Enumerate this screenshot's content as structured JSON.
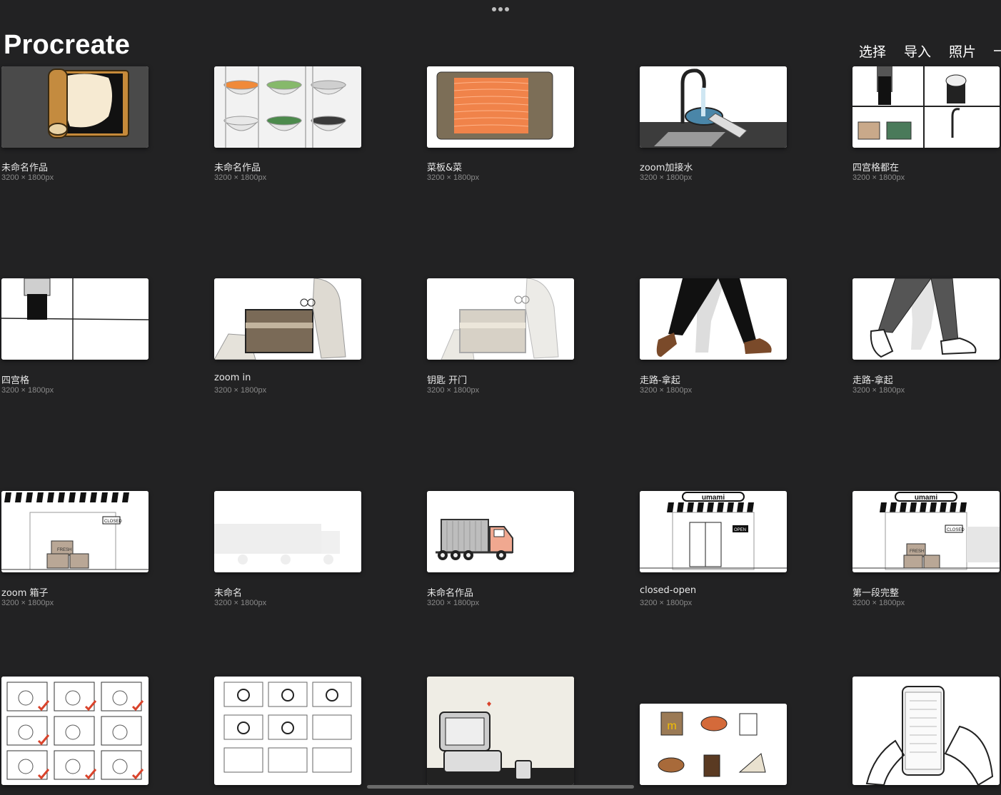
{
  "app": {
    "title": "Procreate"
  },
  "toolbar": {
    "select": "选择",
    "import": "导入",
    "photos": "照片"
  },
  "artworks": [
    {
      "title": "未命名作品",
      "size": "3200 × 1800px",
      "art": "rolling-pin"
    },
    {
      "title": "未命名作品",
      "size": "3200 × 1800px",
      "art": "bowls"
    },
    {
      "title": "菜板&菜",
      "size": "3200 × 1800px",
      "art": "salmon-board"
    },
    {
      "title": "zoom加接水",
      "size": "3200 × 1800px",
      "art": "faucet-bowl"
    },
    {
      "title": "四宫格都在",
      "size": "3200 × 1800px",
      "art": "four-grid-full"
    },
    {
      "title": "四宫格",
      "size": "3200 × 1800px",
      "art": "four-grid"
    },
    {
      "title": "zoom in",
      "size": "3200 × 1800px",
      "art": "key-box"
    },
    {
      "title": "钥匙 开门",
      "size": "3200 × 1800px",
      "art": "key-box-light"
    },
    {
      "title": "走路-拿起",
      "size": "3200 × 1800px",
      "art": "walking-legs"
    },
    {
      "title": "走路-拿起",
      "size": "3200 × 1800px",
      "art": "walking-legs-gray"
    },
    {
      "title": "zoom 箱子",
      "size": "3200 × 1800px",
      "art": "shop-boxes"
    },
    {
      "title": "未命名",
      "size": "3200 × 1800px",
      "art": "faded-truck"
    },
    {
      "title": "未命名作品",
      "size": "3200 × 1800px",
      "art": "truck"
    },
    {
      "title": "closed-open",
      "size": "3200 × 1800px",
      "art": "umami-shop"
    },
    {
      "title": "第一段完整",
      "size": "3200 × 1800px",
      "art": "umami-shop-boxes"
    },
    {
      "title": "",
      "size": "",
      "art": "storyboard-checks"
    },
    {
      "title": "",
      "size": "",
      "art": "storyboard-sketch"
    },
    {
      "title": "",
      "size": "",
      "art": "register"
    },
    {
      "title": "",
      "size": "",
      "art": "food-icons"
    },
    {
      "title": "",
      "size": "",
      "art": "phone-hands"
    }
  ],
  "art_text": {
    "umami": "umami",
    "closed": "CLOSED",
    "open": "OPEN",
    "fresh": "FRESH"
  },
  "colors": {
    "background": "#222223",
    "accent_check": "#d9432b",
    "salmon": "#f0834a",
    "board": "#7c6e57"
  }
}
